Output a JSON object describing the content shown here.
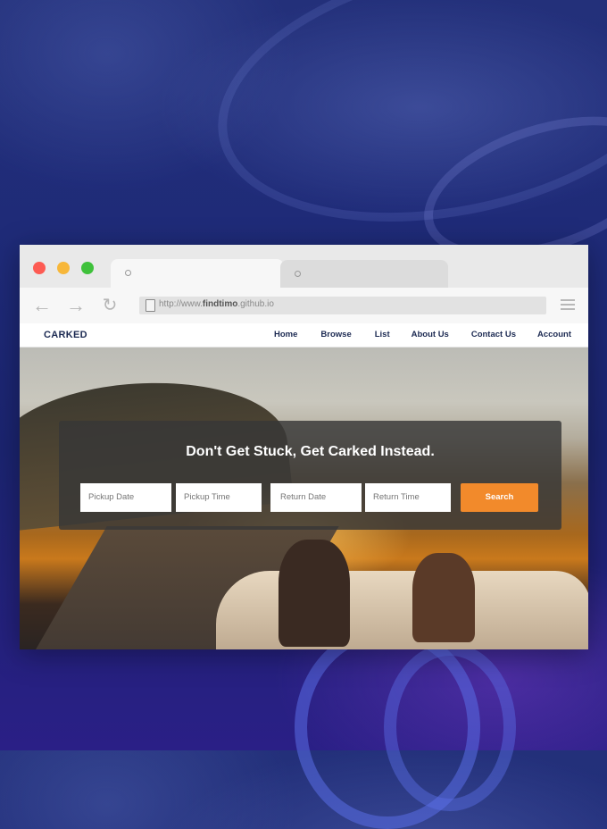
{
  "browser": {
    "tabs": [
      {
        "label": ""
      },
      {
        "label": ""
      }
    ],
    "url": {
      "prefix": "http://www.",
      "bold": "findtimo",
      "suffix": ".github.io"
    },
    "icons": {
      "back": "back-arrow-icon",
      "forward": "forward-arrow-icon",
      "reload": "reload-icon",
      "menu": "hamburger-menu-icon"
    }
  },
  "site": {
    "logo": "CARKED",
    "nav": [
      "Home",
      "Browse",
      "List",
      "About Us",
      "Contact Us",
      "Account"
    ]
  },
  "hero": {
    "headline": "Don't Get Stuck, Get Carked Instead.",
    "fields": {
      "pickup_date": "Pickup Date",
      "pickup_time": "Pickup Time",
      "return_date": "Return Date",
      "return_time": "Return Time"
    },
    "search_label": "Search"
  },
  "colors": {
    "accent": "#f28a2b",
    "brand": "#1c2a52",
    "background": "#1e2a78"
  }
}
